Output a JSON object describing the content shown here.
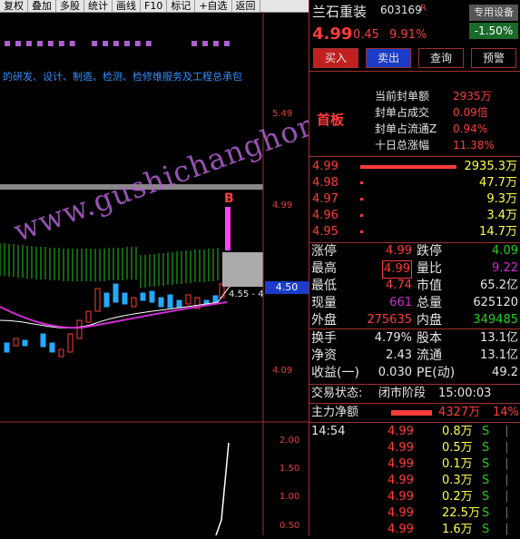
{
  "toolbar": {
    "items": [
      "复权",
      "叠加",
      "多股",
      "统计",
      "画线",
      "F10",
      "标记",
      "+自选",
      "返回"
    ]
  },
  "chart": {
    "description_text": "的研发、设计、制造、检测、检修维服务及工程总承包",
    "price_ticks": [
      "5.49",
      "4.99",
      "4.50",
      "4.09"
    ],
    "current_price_label": "4.50",
    "annotation": "4.55 - 4",
    "marker_b": "B",
    "indicator_ticks": [
      "2.00",
      "1.50",
      "1.00",
      "0.50"
    ],
    "watermark": "www.gushichanghong.com"
  },
  "stock": {
    "name": "兰石重装",
    "code": "603169",
    "flag": "R",
    "price": "4.99",
    "change": "0.45",
    "pct": "9.91%",
    "device_btn": "专用设备",
    "device_pct": "-1.50%"
  },
  "actions": [
    "买入",
    "卖出",
    "查询",
    "预警"
  ],
  "limit": {
    "badge": "首板",
    "lines": [
      {
        "label": "当前封单额",
        "value": "2935万",
        "icon": "!"
      },
      {
        "label": "封单占成交",
        "value": "0.09倍"
      },
      {
        "label": "封单占流通Z",
        "value": "0.94%"
      },
      {
        "label": "十日总涨幅",
        "value": "11.38%"
      }
    ]
  },
  "orderbook": [
    {
      "price": "4.99",
      "vol": "2935.3万",
      "bar": 1.0
    },
    {
      "price": "4.98",
      "vol": "47.7万",
      "bar": 0.02
    },
    {
      "price": "4.97",
      "vol": "9.3万",
      "bar": 0.01
    },
    {
      "price": "4.96",
      "vol": "3.4万",
      "bar": 0.01
    },
    {
      "price": "4.95",
      "vol": "14.7万",
      "bar": 0.01
    }
  ],
  "stats": [
    {
      "l1": "涨停",
      "v1": "4.99",
      "c1": "rd",
      "l2": "跌停",
      "v2": "4.09",
      "c2": "gn"
    },
    {
      "l1": "最高",
      "v1": "4.99",
      "c1": "rd",
      "l2": "量比",
      "v2": "9.22",
      "c2": "mg"
    },
    {
      "l1": "最低",
      "v1": "4.74",
      "c1": "rd",
      "l2": "市值",
      "v2": "65.2亿",
      "c2": "wt"
    },
    {
      "l1": "现量",
      "v1": "661",
      "c1": "mg",
      "l2": "总量",
      "v2": "625120",
      "c2": "wt"
    },
    {
      "l1": "外盘",
      "v1": "275635",
      "c1": "rd",
      "l2": "内盘",
      "v2": "349485",
      "c2": "gn"
    }
  ],
  "finance": [
    {
      "l1": "换手",
      "v1": "4.79%",
      "l2": "股本",
      "v2": "13.1亿"
    },
    {
      "l1": "净资",
      "v1": "2.43",
      "l2": "流通",
      "v2": "13.1亿"
    },
    {
      "l1": "收益(一)",
      "v1": "0.030",
      "l2": "PE(动)",
      "v2": "49.2"
    }
  ],
  "status": {
    "label": "交易状态:",
    "value": "闭市阶段",
    "time": "15:00:03"
  },
  "main_flow": {
    "label": "主力净额",
    "value": "4327万",
    "pct": "14%"
  },
  "ticks": [
    {
      "time": "14:54",
      "price": "4.99",
      "vol": "0.8万",
      "side": "S"
    },
    {
      "time": "",
      "price": "4.99",
      "vol": "0.5万",
      "side": "S"
    },
    {
      "time": "",
      "price": "4.99",
      "vol": "0.1万",
      "side": "S"
    },
    {
      "time": "",
      "price": "4.99",
      "vol": "0.3万",
      "side": "S"
    },
    {
      "time": "",
      "price": "4.99",
      "vol": "0.2万",
      "side": "S"
    },
    {
      "time": "",
      "price": "4.99",
      "vol": "22.5万",
      "side": "S"
    },
    {
      "time": "",
      "price": "4.99",
      "vol": "1.6万",
      "side": "S"
    }
  ]
}
